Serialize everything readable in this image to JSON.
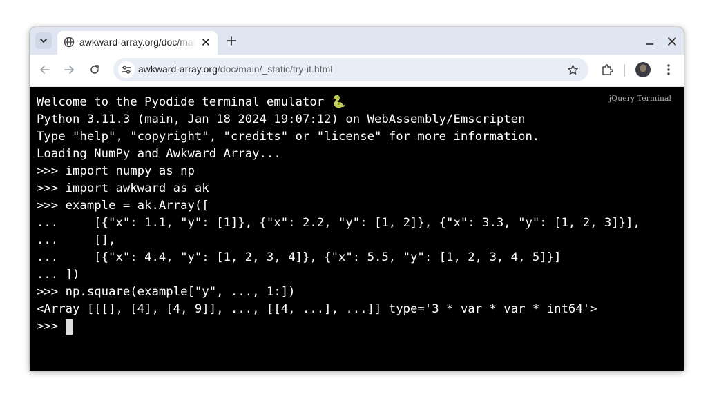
{
  "browser": {
    "tab": {
      "title": "awkward-array.org/doc/main/_static/try-it.html"
    },
    "address": {
      "domain": "awkward-array.org",
      "path": "/doc/main/_static/try-it.html"
    }
  },
  "terminal": {
    "badge": "jQuery Terminal",
    "lines": [
      "Welcome to the Pyodide terminal emulator 🐍",
      "Python 3.11.3 (main, Jan 18 2024 19:07:12) on WebAssembly/Emscripten",
      "Type \"help\", \"copyright\", \"credits\" or \"license\" for more information.",
      "Loading NumPy and Awkward Array...",
      ">>> import numpy as np",
      ">>> import awkward as ak",
      ">>> example = ak.Array([",
      "...     [{\"x\": 1.1, \"y\": [1]}, {\"x\": 2.2, \"y\": [1, 2]}, {\"x\": 3.3, \"y\": [1, 2, 3]}],",
      "...     [],",
      "...     [{\"x\": 4.4, \"y\": [1, 2, 3, 4]}, {\"x\": 5.5, \"y\": [1, 2, 3, 4, 5]}]",
      "... ])",
      ">>> np.square(example[\"y\", ..., 1:])",
      "<Array [[[], [4], [4, 9]], ..., [[4, ...], ...]] type='3 * var * var * int64'>"
    ],
    "prompt": ">>> "
  },
  "colors": {
    "tabstrip": "#dfe6f1",
    "omnibox": "#e9eef6",
    "terminal_bg": "#000000",
    "terminal_fg": "#ffffff"
  }
}
